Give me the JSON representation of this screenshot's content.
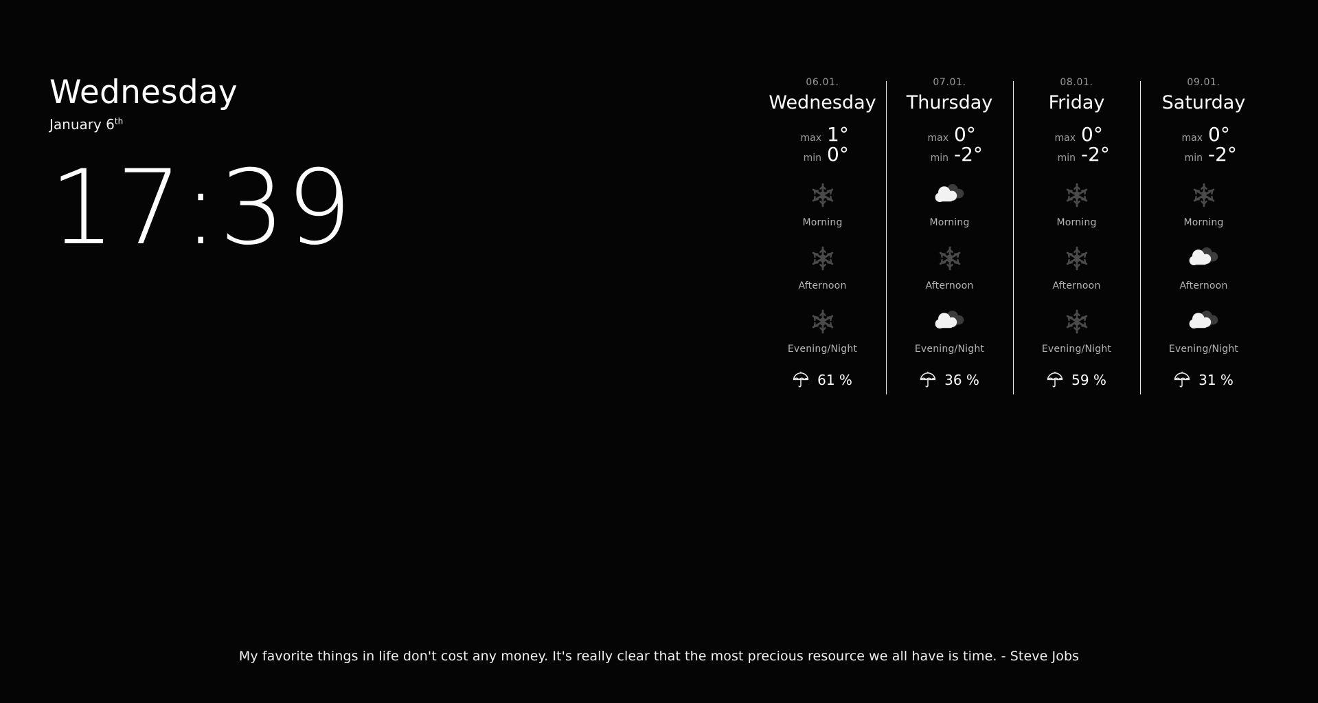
{
  "colors": {
    "background": "#050505",
    "text_primary": "#ffffff",
    "text_muted": "#9a9a9a",
    "icon_snow": "#4a4a4a",
    "icon_cloud_front": "#f2f2f2",
    "icon_cloud_back": "#3c3c3c",
    "divider": "#e8e8e8"
  },
  "clock": {
    "day_name": "Wednesday",
    "date_month_day": "January 6",
    "date_ordinal": "th",
    "time": "17:39"
  },
  "forecast": {
    "slot_labels": [
      "Morning",
      "Afternoon",
      "Evening/Night"
    ],
    "max_label": "max",
    "min_label": "min",
    "precip_icon": "umbrella-icon",
    "days": [
      {
        "date": "06.01.",
        "day_name": "Wednesday",
        "max": "1°",
        "min": "0°",
        "slots": [
          {
            "label": "Morning",
            "icon": "snowflake-icon"
          },
          {
            "label": "Afternoon",
            "icon": "snowflake-icon"
          },
          {
            "label": "Evening/Night",
            "icon": "snowflake-icon"
          }
        ],
        "precipitation": "61 %"
      },
      {
        "date": "07.01.",
        "day_name": "Thursday",
        "max": "0°",
        "min": "-2°",
        "slots": [
          {
            "label": "Morning",
            "icon": "cloudy-icon"
          },
          {
            "label": "Afternoon",
            "icon": "snowflake-icon"
          },
          {
            "label": "Evening/Night",
            "icon": "cloudy-icon"
          }
        ],
        "precipitation": "36 %"
      },
      {
        "date": "08.01.",
        "day_name": "Friday",
        "max": "0°",
        "min": "-2°",
        "slots": [
          {
            "label": "Morning",
            "icon": "snowflake-icon"
          },
          {
            "label": "Afternoon",
            "icon": "snowflake-icon"
          },
          {
            "label": "Evening/Night",
            "icon": "snowflake-icon"
          }
        ],
        "precipitation": "59 %"
      },
      {
        "date": "09.01.",
        "day_name": "Saturday",
        "max": "0°",
        "min": "-2°",
        "slots": [
          {
            "label": "Morning",
            "icon": "snowflake-icon"
          },
          {
            "label": "Afternoon",
            "icon": "cloudy-icon"
          },
          {
            "label": "Evening/Night",
            "icon": "cloudy-icon"
          }
        ],
        "precipitation": "31 %"
      }
    ]
  },
  "quote": {
    "text": "My favorite things in life don't cost any money. It's really clear that the most precious resource we all have is time. - Steve Jobs"
  }
}
